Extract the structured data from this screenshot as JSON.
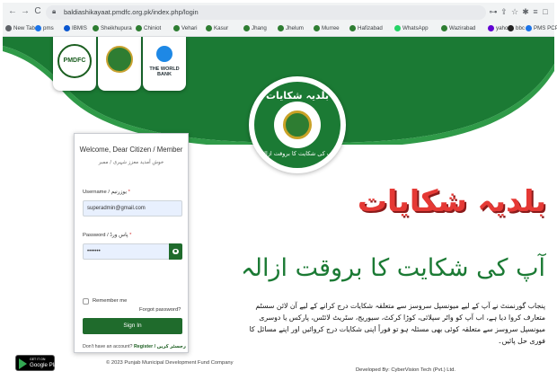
{
  "browser": {
    "nav": {
      "back": "←",
      "forward": "→",
      "reload": "C"
    },
    "url": "baldiashikayaat.pmdfc.org.pk/index.php/login",
    "controls": [
      "⊶",
      "⇪",
      "☆",
      "✱",
      "≡",
      "□",
      "👤"
    ],
    "bookmarks": [
      {
        "label": "New Tab",
        "color": "#5f6368"
      },
      {
        "label": "pms",
        "color": "#1a73e8"
      },
      {
        "label": "IBMIS",
        "color": "#0b57d0"
      },
      {
        "label": "Sheikhupura",
        "color": "#2e7d32"
      },
      {
        "label": "Chiniot",
        "color": "#2e7d32"
      },
      {
        "label": "Vehari",
        "color": "#2e7d32"
      },
      {
        "label": "Kasur",
        "color": "#2e7d32"
      },
      {
        "label": "Jhang",
        "color": "#2e7d32"
      },
      {
        "label": "Jhelum",
        "color": "#2e7d32"
      },
      {
        "label": "Murree",
        "color": "#2e7d32"
      },
      {
        "label": "Hafizabad",
        "color": "#2e7d32"
      },
      {
        "label": "WhatsApp",
        "color": "#25d366"
      },
      {
        "label": "Wazirabad",
        "color": "#2e7d32"
      },
      {
        "label": "yahoo",
        "color": "#6001d2"
      },
      {
        "label": "bbc",
        "color": "#222222"
      },
      {
        "label": "PMS PCP Activities",
        "color": "#1a73e8"
      }
    ]
  },
  "partners": {
    "pmdfc": "PMDFC",
    "world_bank": "THE WORLD BANK"
  },
  "seal": {
    "top": "بلدیہ شکایات",
    "bottom": "آپ کی شکایت کا بروقت ازالہ"
  },
  "login": {
    "welcome": "Welcome, Dear Citizen / Member",
    "welcome_urdu": "خوش آمدید معزز شہری / ممبر",
    "username_label": "Username / یوزرنیم",
    "username_value": "superadmin@gmail.com",
    "password_label": "Password / پاس ورڈ",
    "password_value": "•••••••",
    "remember": "Remember me",
    "forgot": "Forgot password?",
    "signin": "Sign In",
    "no_account": "Don't have an account?",
    "register": "Register / رجسٹر کریں"
  },
  "hero": {
    "headline": "بلدیہ شکایات",
    "tagline": "آپ کی شکایت کا بروقت ازالہ",
    "paragraph": "پنجاب گورنمنٹ نے آپ کے لیے میونسپل سروسز سے متعلقہ شکایات درج کرانے کے لیے آن لائن سسٹم متعارف کروا دیا ہے، اب آپ کو واٹر سپلائی، کوڑا کرکٹ، سیوریج، سٹریٹ لائٹس، پارکس یا دوسری میونسپل سروسز سے متعلقہ کوئی بھی مسئلہ ہو تو فوراً اپنی شکایات درج کروائیں اور اپنے مسائل کا فوری حل پائیں۔"
  },
  "footer": {
    "gplay_small": "GET IT ON",
    "gplay_big": "Google Play",
    "copyright": "© 2023 Punjab Municipal Development Fund Company",
    "developed": "Developed By: CyberVision Tech (Pvt.) Ltd."
  },
  "colors": {
    "brand_green": "#1b7a34",
    "headline_red": "#e53935",
    "button_green": "#1f6b2c"
  }
}
